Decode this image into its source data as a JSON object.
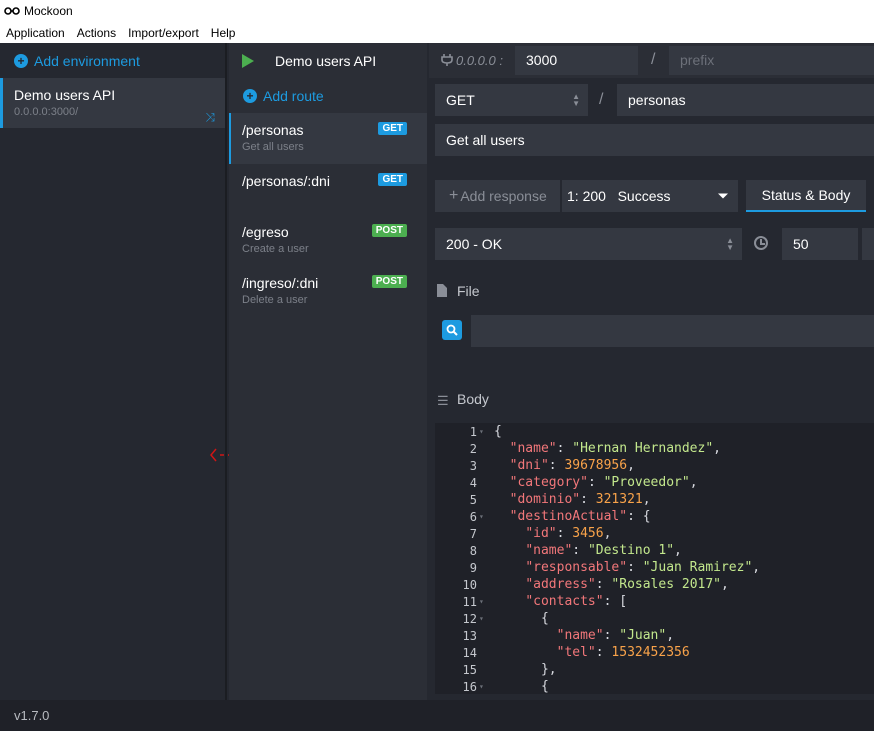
{
  "window": {
    "title": "Mockoon"
  },
  "menu": [
    "Application",
    "Actions",
    "Import/export",
    "Help"
  ],
  "environments": {
    "add_label": "Add environment",
    "items": [
      {
        "name": "Demo users API",
        "host": "0.0.0.0:3000/"
      }
    ]
  },
  "env_bar": {
    "title": "Demo users API"
  },
  "host": {
    "ip": "0.0.0.0 :",
    "port": "3000",
    "slash": "/",
    "prefix_placeholder": "prefix"
  },
  "routes": {
    "add_label": "Add route",
    "items": [
      {
        "path": "/personas",
        "desc": "Get all users",
        "method": "GET",
        "active": true
      },
      {
        "path": "/personas/:dni",
        "desc": "",
        "method": "GET",
        "active": false
      },
      {
        "path": "/egreso",
        "desc": "Create a user",
        "method": "POST",
        "active": false
      },
      {
        "path": "/ingreso/:dni",
        "desc": "Delete a user",
        "method": "POST",
        "active": false
      }
    ]
  },
  "route_editor": {
    "method": "GET",
    "slash": "/",
    "path": "personas",
    "description": "Get all users"
  },
  "response": {
    "add_label": "Add response",
    "selected": "1: 200   Success",
    "tab": "Status & Body",
    "status": "200 - OK",
    "latency": "50"
  },
  "sections": {
    "file": "File",
    "body": "Body"
  },
  "body_code": [
    {
      "n": "1",
      "fold": true,
      "indent": 0,
      "tokens": [
        [
          "p",
          "{"
        ]
      ]
    },
    {
      "n": "2",
      "fold": false,
      "indent": 1,
      "tokens": [
        [
          "k",
          "\"name\""
        ],
        [
          "p",
          ": "
        ],
        [
          "s",
          "\"Hernan Hernandez\""
        ],
        [
          "p",
          ","
        ]
      ]
    },
    {
      "n": "3",
      "fold": false,
      "indent": 1,
      "tokens": [
        [
          "k",
          "\"dni\""
        ],
        [
          "p",
          ": "
        ],
        [
          "n",
          "39678956"
        ],
        [
          "p",
          ","
        ]
      ]
    },
    {
      "n": "4",
      "fold": false,
      "indent": 1,
      "tokens": [
        [
          "k",
          "\"category\""
        ],
        [
          "p",
          ": "
        ],
        [
          "s",
          "\"Proveedor\""
        ],
        [
          "p",
          ","
        ]
      ]
    },
    {
      "n": "5",
      "fold": false,
      "indent": 1,
      "tokens": [
        [
          "k",
          "\"dominio\""
        ],
        [
          "p",
          ": "
        ],
        [
          "n",
          "321321"
        ],
        [
          "p",
          ","
        ]
      ]
    },
    {
      "n": "6",
      "fold": true,
      "indent": 1,
      "tokens": [
        [
          "k",
          "\"destinoActual\""
        ],
        [
          "p",
          ": {"
        ]
      ]
    },
    {
      "n": "7",
      "fold": false,
      "indent": 2,
      "tokens": [
        [
          "k",
          "\"id\""
        ],
        [
          "p",
          ": "
        ],
        [
          "n",
          "3456"
        ],
        [
          "p",
          ","
        ]
      ]
    },
    {
      "n": "8",
      "fold": false,
      "indent": 2,
      "tokens": [
        [
          "k",
          "\"name\""
        ],
        [
          "p",
          ": "
        ],
        [
          "s",
          "\"Destino 1\""
        ],
        [
          "p",
          ","
        ]
      ]
    },
    {
      "n": "9",
      "fold": false,
      "indent": 2,
      "tokens": [
        [
          "k",
          "\"responsable\""
        ],
        [
          "p",
          ": "
        ],
        [
          "s",
          "\"Juan Ramirez\""
        ],
        [
          "p",
          ","
        ]
      ]
    },
    {
      "n": "10",
      "fold": false,
      "indent": 2,
      "tokens": [
        [
          "k",
          "\"address\""
        ],
        [
          "p",
          ": "
        ],
        [
          "s",
          "\"Rosales 2017\""
        ],
        [
          "p",
          ","
        ]
      ]
    },
    {
      "n": "11",
      "fold": true,
      "indent": 2,
      "tokens": [
        [
          "k",
          "\"contacts\""
        ],
        [
          "p",
          ": ["
        ]
      ]
    },
    {
      "n": "12",
      "fold": true,
      "indent": 3,
      "tokens": [
        [
          "p",
          "{"
        ]
      ]
    },
    {
      "n": "13",
      "fold": false,
      "indent": 4,
      "tokens": [
        [
          "k",
          "\"name\""
        ],
        [
          "p",
          ": "
        ],
        [
          "s",
          "\"Juan\""
        ],
        [
          "p",
          ","
        ]
      ]
    },
    {
      "n": "14",
      "fold": false,
      "indent": 4,
      "tokens": [
        [
          "k",
          "\"tel\""
        ],
        [
          "p",
          ": "
        ],
        [
          "n",
          "1532452356"
        ]
      ]
    },
    {
      "n": "15",
      "fold": false,
      "indent": 3,
      "tokens": [
        [
          "p",
          "},"
        ]
      ]
    },
    {
      "n": "16",
      "fold": true,
      "indent": 3,
      "tokens": [
        [
          "p",
          "{"
        ]
      ]
    }
  ],
  "status_bar": {
    "version": "v1.7.0"
  },
  "colors": {
    "accent": "#1d9be0",
    "get_badge": "#1d9be0",
    "post_badge": "#4caf50",
    "play": "#4caf50"
  },
  "icons": [
    "mockoon-logo-icon",
    "add-environment-icon",
    "shuffle-icon",
    "play-icon",
    "add-route-icon",
    "plug-icon",
    "clock-icon",
    "file-icon",
    "file-search-icon",
    "body-icon",
    "resize-handle-icon"
  ]
}
